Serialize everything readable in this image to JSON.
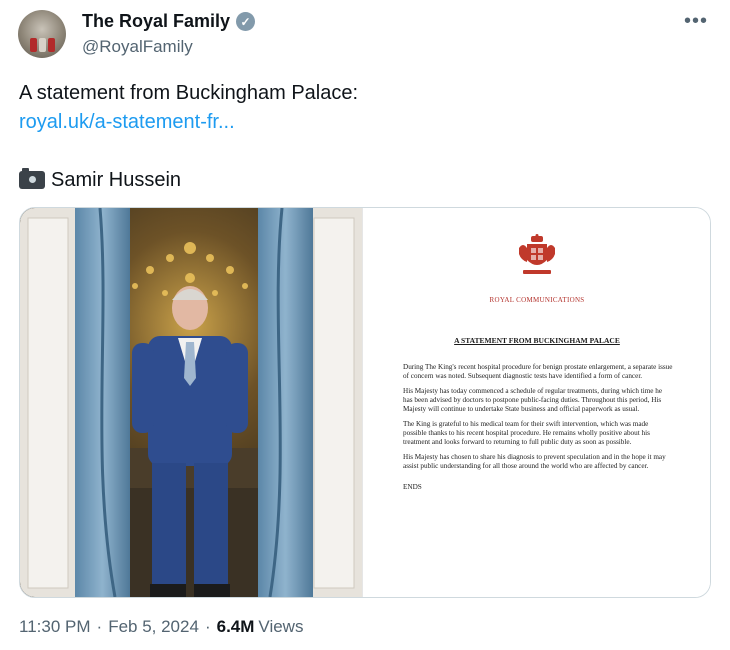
{
  "author": {
    "display_name": "The Royal Family",
    "handle": "@RoyalFamily",
    "verified_color": "#829aab"
  },
  "tweet": {
    "text": "A statement from Buckingham Palace:",
    "link": "royal.uk/a-statement-fr...",
    "photo_credit": "Samir Hussein",
    "credit_icon": "camera-icon"
  },
  "document": {
    "heading": "ROYAL COMMUNICATIONS",
    "title": "A STATEMENT FROM BUCKINGHAM PALACE",
    "paragraphs": [
      "During The King's recent hospital procedure for benign prostate enlargement, a separate issue of concern was noted. Subsequent diagnostic tests have identified a form of cancer.",
      "His Majesty has today commenced a schedule of regular treatments, during which time he has been advised by doctors to postpone public-facing duties. Throughout this period, His Majesty will continue to undertake State business and official paperwork as usual.",
      "The King is grateful to his medical team for their swift intervention, which was made possible thanks to his recent hospital procedure. He remains wholly positive about his treatment and looks forward to returning to full public duty as soon as possible.",
      "His Majesty has chosen to share his diagnosis to prevent speculation and in the hope it may assist public understanding for all those around the world who are affected by cancer."
    ],
    "ends": "ENDS",
    "accent_color": "#b3322c"
  },
  "meta": {
    "time": "11:30 PM",
    "date": "Feb 5, 2024",
    "views_count": "6.4M",
    "views_label": "Views",
    "separator": "·"
  }
}
